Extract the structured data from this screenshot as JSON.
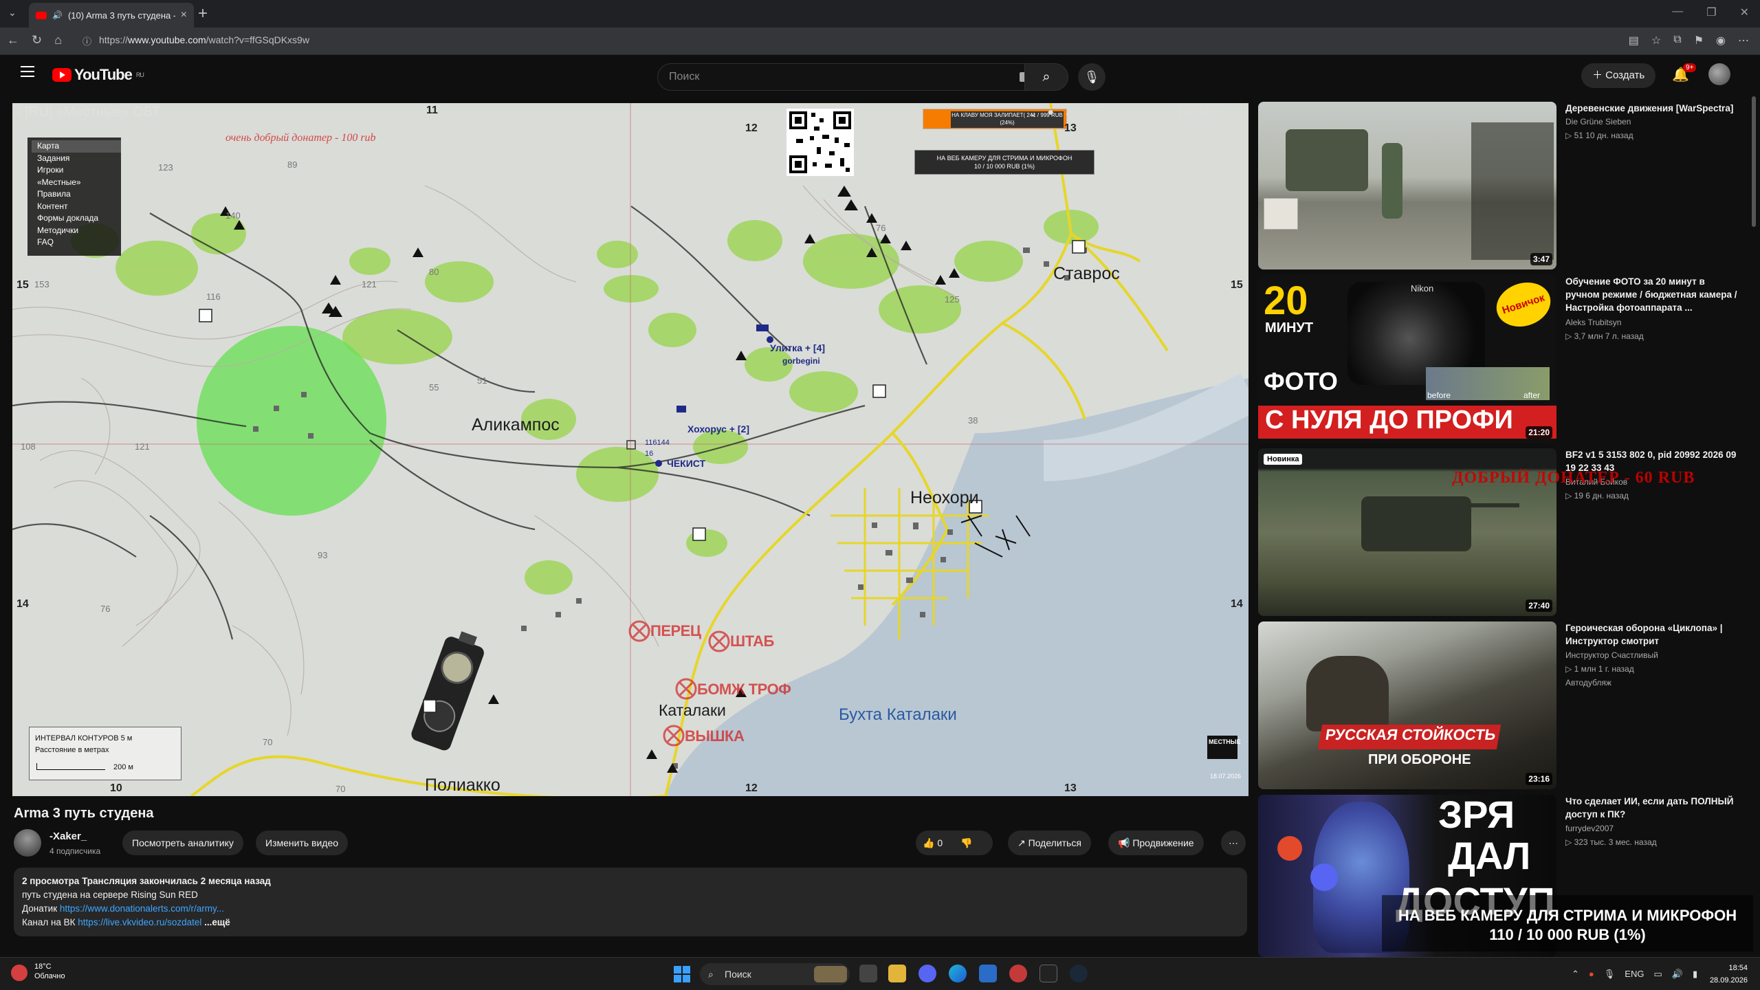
{
  "browser": {
    "tab_title": "(10) Arma 3 путь студена - Yo",
    "url_prefix": "https://",
    "url_host": "www.youtube.com",
    "url_path": "/watch?v=ffGSqDKxs9w"
  },
  "youtube": {
    "logo_text": "YouTube",
    "region": "RU",
    "search_placeholder": "Поиск",
    "create_label": "Создать",
    "notif_count": "9+"
  },
  "game": {
    "window_title": "[RU] «Местные» ОБТ",
    "clock": "10:04",
    "clock_seconds": "17",
    "map_menu": [
      "Карта",
      "Задания",
      "Игроки",
      "«Местные»",
      "Правила",
      "Контент",
      "Формы доклада",
      "Методички",
      "FAQ"
    ],
    "donation_note": "очень добрый донатер - 100 rub",
    "donate_goal": "НА КЛАВУ МОЯ ЗАЛИПАЕТ( 241 / 999 RUB (24%)",
    "cam_goal_top": "НА ВЕБ КАМЕРУ ДЛЯ СТРИМА И МИКРОФОН",
    "cam_goal_bottom": "10 / 10 000 RUB (1%)",
    "legend_line1": "ИНТЕРВАЛ КОНТУРОВ 5 м",
    "legend_line2": "Расстояние в метрах",
    "legend_scale": "200 м",
    "towns": {
      "alikampos": "Аликампос",
      "stavros": "Ставрос",
      "neohori": "Неохори",
      "katalaki": "Каталаки",
      "polyakko": "Полиакко",
      "bay": "Бухта Каталаки"
    },
    "markers": {
      "perets": "ПЕРЕЦ",
      "shtab": "ШТАБ",
      "bomzh": "БОМЖ ТРОФ",
      "vyshka": "ВЫШКА",
      "unit1": "Улитка + [4]",
      "unit1b": "gorbegini",
      "unit2": "Хохорус + [2]",
      "unit3": "ЧЕКИСТ",
      "coords": "116144",
      "coords2": "16"
    },
    "grid_labels": {
      "x11": "11",
      "x12": "12",
      "x13": "13",
      "x10": "10",
      "x12b": "12",
      "x13b": "13",
      "y15": "15",
      "y15r": "15",
      "y14": "14",
      "y14r": "14"
    },
    "elevations": [
      "123",
      "89",
      "140",
      "116",
      "153",
      "121",
      "80",
      "93",
      "76",
      "108",
      "121",
      "55",
      "51",
      "70",
      "70",
      "38",
      "76",
      "125"
    ],
    "logo": "МЕСТНЫЕ",
    "stamp_date": "18.07.2026"
  },
  "video": {
    "title": "Arma 3 путь студена",
    "channel": "-Xaker_",
    "subs": "4 подписчика",
    "btn_analytics": "Посмотреть аналитику",
    "btn_edit": "Изменить видео",
    "likes": "0",
    "share": "Поделиться",
    "promote": "Продвижение",
    "desc_meta": "2 просмотра  Трансляция закончилась 2 месяца назад",
    "desc_line1": "путь студена на сервере Rising Sun RED",
    "desc_donat_label": "Донатик ",
    "desc_donat_link": "https://www.donationalerts.com/r/army...",
    "desc_vk_label": "Канал на ВК ",
    "desc_vk_link": "https://live.vkvideo.ru/sozdatel",
    "desc_more": " ...ещё"
  },
  "recommendations": [
    {
      "title": "Деревенские движения [WarSpectra]",
      "channel": "Die Grüne Sieben",
      "stats": "▷ 51   10 дн. назад",
      "duration": "3:47"
    },
    {
      "title": "Обучение ФОТО за 20 минут в ручном режиме / бюджетная камера / Настройка фотоаппарата ...",
      "channel": "Aleks Trubitsyn",
      "stats": "▷ 3,7 млн   7 л. назад",
      "duration": "21:20",
      "thumb_big": "20",
      "thumb_min": "МИНУТ",
      "thumb_foto": "ФОТО",
      "thumb_banner": "С НУЛЯ ДО ПРОФИ",
      "thumb_badge": "Новичок",
      "thumb_before": "before",
      "thumb_after": "after",
      "thumb_brand": "Nikon"
    },
    {
      "title": "BF2 v1 5 3153 802 0, pid 20992 2026 09 19 22 33 43",
      "channel": "Виталий Бойков",
      "stats": "▷ 19   6 дн. назад",
      "duration": "27:40",
      "badge": "Новинка",
      "overlay": "ДОБРЫЙ ДОНАТЕР - 60 RUB"
    },
    {
      "title": "Героическая оборона «Циклопа» | Инструктор смотрит",
      "channel": "Инструктор Счастливый",
      "stats": "▷ 1 млн   1 г. назад",
      "stats2": "Автодубляж",
      "duration": "23:16",
      "thumb_line1": "РУССКАЯ СТОЙКОСТЬ",
      "thumb_line2": "ПРИ ОБОРОНЕ"
    },
    {
      "title": "Что сделает ИИ, если дать ПОЛНЫЙ доступ к ПК?",
      "channel": "furrydev2007",
      "stats": "▷ 323 тыс.   3 мес. назад",
      "thumb_line1": "ЗРЯ",
      "thumb_line2": "ДАЛ",
      "thumb_line3": "ДОСТУП"
    }
  ],
  "overlay_banner": {
    "line1": "НА ВЕБ КАМЕРУ ДЛЯ СТРИМА И МИКРОФОН",
    "line2": "110 / 10 000 RUB (1%)"
  },
  "taskbar": {
    "temp": "18°C",
    "weather": "Облачно",
    "search": "Поиск",
    "lang": "ENG",
    "time": "18:54",
    "date": "28.09.2026"
  }
}
